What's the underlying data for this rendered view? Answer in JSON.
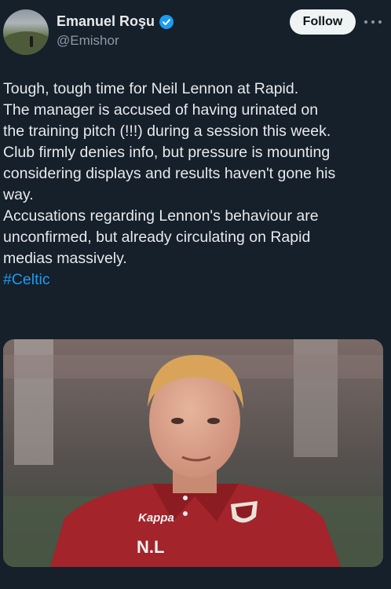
{
  "author": {
    "display_name": "Emanuel Roşu",
    "handle": "@Emishor",
    "verified": true,
    "avatar_icon": "landscape-avatar"
  },
  "actions": {
    "follow_label": "Follow",
    "more_icon": "more-horizontal-icon"
  },
  "tweet": {
    "paragraph1_lines": [
      "Tough, tough time for Neil Lennon at Rapid.",
      "The manager is accused of having urinated on",
      "the training pitch (!!!) during a session this week.",
      "Club firmly denies info, but pressure is mounting",
      "considering displays and results haven't gone his",
      "way."
    ],
    "paragraph2_lines": [
      "Accusations regarding Lennon's behaviour are",
      "unconfirmed, but already circulating on Rapid",
      "medias massively."
    ],
    "hashtag": "#Celtic"
  },
  "media": {
    "shirt_brand": "Kappa",
    "shirt_initials": "N.L",
    "colors": {
      "shirt": "#a3242a",
      "background": "#5e5451"
    }
  },
  "colors": {
    "background": "#15202b",
    "text": "#e7e9ea",
    "secondary": "#8b98a5",
    "accent": "#1d9bf0",
    "follow_bg": "#eff3f4"
  }
}
